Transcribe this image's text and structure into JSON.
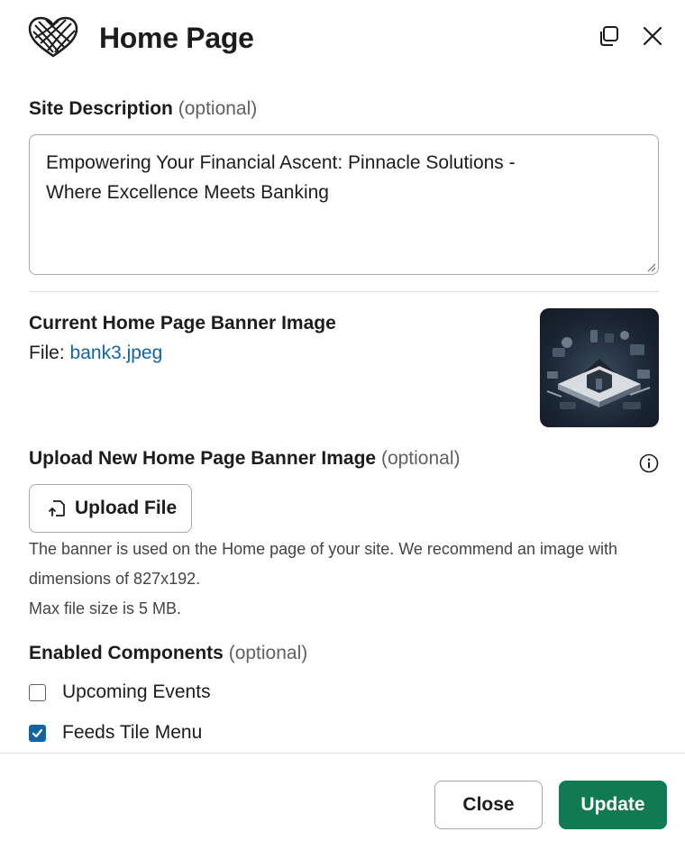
{
  "header": {
    "title": "Home Page",
    "logo_icon": "heart-knot-logo",
    "popout_icon": "popout-icon",
    "close_icon": "close-icon"
  },
  "site_description": {
    "label": "Site Description",
    "optional": "(optional)",
    "value": "Empowering Your Financial Ascent: Pinnacle Solutions -\nWhere Excellence Meets Banking"
  },
  "current_banner": {
    "label": "Current Home Page Banner Image",
    "file_prefix": "File:",
    "file_name": "bank3.jpeg"
  },
  "upload_banner": {
    "label": "Upload New Home Page Banner Image",
    "optional": "(optional)",
    "button_label": "Upload File",
    "help_line1": "The banner is used on the Home page of your site. We recommend an image with",
    "help_line2": "dimensions of 827x192.",
    "help_line3": "Max file size is 5 MB."
  },
  "components": {
    "label": "Enabled Components",
    "optional": "(optional)",
    "items": [
      {
        "label": "Upcoming Events",
        "checked": false
      },
      {
        "label": "Feeds Tile Menu",
        "checked": true
      }
    ]
  },
  "footer": {
    "close_label": "Close",
    "update_label": "Update"
  },
  "colors": {
    "accent_blue": "#1264a3",
    "update_green": "#117a52"
  }
}
